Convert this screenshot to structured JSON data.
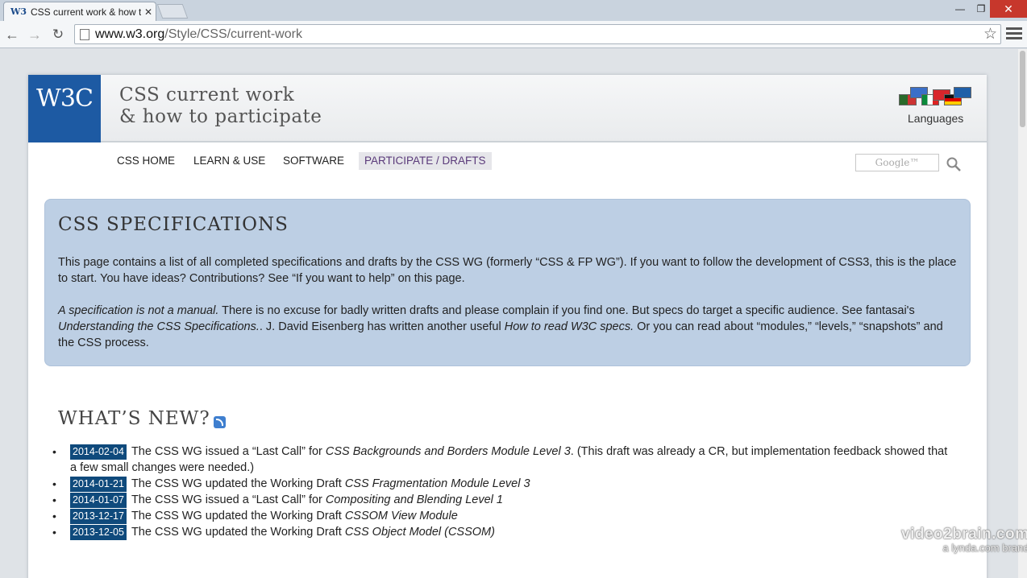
{
  "browser": {
    "tab_title": "CSS current work & how t",
    "tab_favicon": "W3",
    "url_domain": "www.w3.org",
    "url_path": "/Style/CSS/current-work",
    "window_controls": {
      "minimize": "—",
      "maximize": "❐",
      "close": "✕"
    }
  },
  "header": {
    "logo": "W3C",
    "title_line1": "CSS current work",
    "title_line2": "& how to participate",
    "languages_label": "Languages"
  },
  "nav": {
    "items": [
      "CSS HOME",
      "LEARN & USE",
      "SOFTWARE",
      "PARTICIPATE / DRAFTS"
    ],
    "active_index": 3,
    "search_placeholder": "Google™"
  },
  "specs": {
    "heading": "CSS SPECIFICATIONS",
    "p1": "This page contains a list of all completed specifications and drafts by the CSS WG (formerly “CSS & FP WG”). If you want to follow the development of CSS3, this is the place to start. You have ideas? Contributions? See “If you want to help” on this page.",
    "p2_em1": "A specification is not a manual.",
    "p2_a": " There is no excuse for badly written drafts and please complain if you find one. But specs do target a specific audience. See fantasai's ",
    "p2_em2": "Understanding the CSS Specifications.",
    "p2_b": ". J. David Eisenberg has written another useful ",
    "p2_em3": "How to read W3C specs.",
    "p2_c": " Or you can read about “modules,” “levels,” “snapshots” and the CSS process."
  },
  "whats_new": {
    "heading": "WHAT’S NEW?",
    "items": [
      {
        "date": "2014-02-04",
        "text_a": "The CSS WG issued a “Last Call” for ",
        "em": "CSS Backgrounds and Borders Module Level 3",
        "text_b": ". (This draft was already a CR, but implementation feedback showed that a few small changes were needed.)"
      },
      {
        "date": "2014-01-21",
        "text_a": "The CSS WG updated the Working Draft ",
        "em": "CSS Fragmentation Module Level 3",
        "text_b": ""
      },
      {
        "date": "2014-01-07",
        "text_a": "The CSS WG issued a “Last Call” for ",
        "em": "Compositing and Blending Level 1",
        "text_b": ""
      },
      {
        "date": "2013-12-17",
        "text_a": "The CSS WG updated the Working Draft ",
        "em": "CSSOM View Module",
        "text_b": ""
      },
      {
        "date": "2013-12-05",
        "text_a": "The CSS WG updated the Working Draft ",
        "em": "CSS Object Model (CSSOM)",
        "text_b": ""
      }
    ]
  },
  "watermark": {
    "brand": "video2brain.com",
    "sub": "a lynda.com brand"
  },
  "colors": {
    "accent_blue": "#1d5aa3",
    "date_badge": "#0f4a7c",
    "spec_box": "#bdcfe4"
  }
}
